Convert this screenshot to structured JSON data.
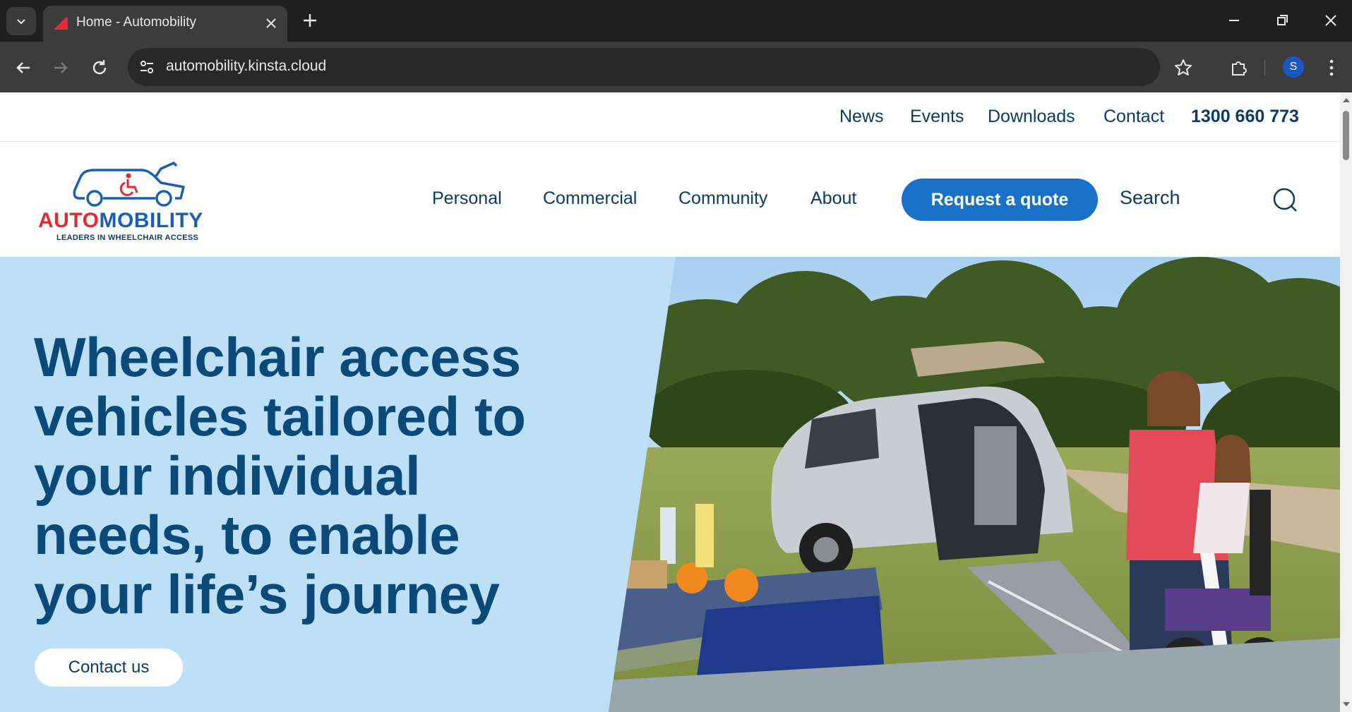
{
  "browser": {
    "tab_title": "Home - Automobility",
    "url": "automobility.kinsta.cloud",
    "profile_initial": "S",
    "icons": [
      "tab-list-icon",
      "favicon-icon",
      "close-icon",
      "plus-icon",
      "minimize-icon",
      "restore-icon",
      "close-window-icon",
      "back-icon",
      "forward-icon",
      "reload-icon",
      "site-info-icon",
      "star-icon",
      "extensions-icon",
      "menu-icon"
    ]
  },
  "utility_nav": {
    "items": [
      {
        "label": "News"
      },
      {
        "label": "Events"
      },
      {
        "label": "Downloads"
      },
      {
        "label": "Contact"
      }
    ],
    "phone": "1300 660 773"
  },
  "logo": {
    "brand_part1": "AUTO",
    "brand_part2": "MOBILITY",
    "tagline": "LEADERS IN WHEELCHAIR ACCESS"
  },
  "main_nav": {
    "items": [
      {
        "label": "Personal"
      },
      {
        "label": "Commercial"
      },
      {
        "label": "Community"
      },
      {
        "label": "About"
      }
    ],
    "cta_label": "Request a quote",
    "search_label": "Search"
  },
  "hero": {
    "headline_lines": [
      "Wheelchair access",
      "vehicles tailored to",
      "your individual",
      "needs, to enable",
      "your life’s journey"
    ],
    "cta_label": "Contact us"
  },
  "colors": {
    "brand_navy": "#0b3b65",
    "brand_blue": "#1a72c8",
    "brand_red": "#e62a33",
    "hero_bg": "#bde0f6"
  }
}
